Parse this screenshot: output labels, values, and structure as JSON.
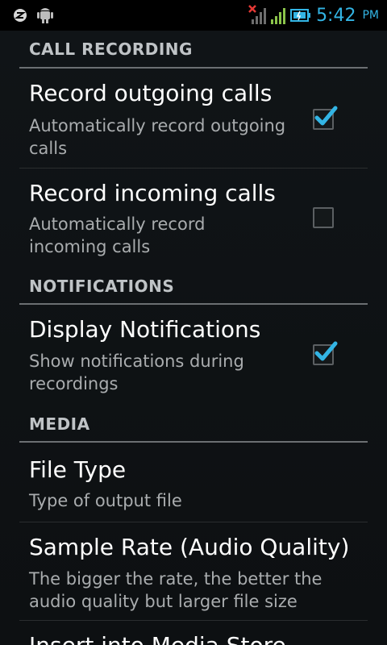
{
  "status_bar": {
    "time": "5:42",
    "ampm": "PM",
    "accent": "#33b5e5"
  },
  "sections": {
    "call_recording": {
      "header": "CALL RECORDING"
    },
    "notifications": {
      "header": "NOTIFICATIONS"
    },
    "media": {
      "header": "MEDIA"
    }
  },
  "prefs": {
    "record_outgoing": {
      "title": "Record outgoing calls",
      "summary": "Automatically record outgoing calls",
      "checked": true
    },
    "record_incoming": {
      "title": "Record incoming calls",
      "summary": "Automatically record incoming calls",
      "checked": false
    },
    "display_notifications": {
      "title": "Display Notifications",
      "summary": "Show notifications during recordings",
      "checked": true
    },
    "file_type": {
      "title": "File Type",
      "summary": "Type of output file"
    },
    "sample_rate": {
      "title": "Sample Rate (Audio Quality)",
      "summary": "The bigger the rate, the better the audio quality but larger file size"
    },
    "insert_media_store": {
      "title": "Insert into Media Store"
    }
  }
}
